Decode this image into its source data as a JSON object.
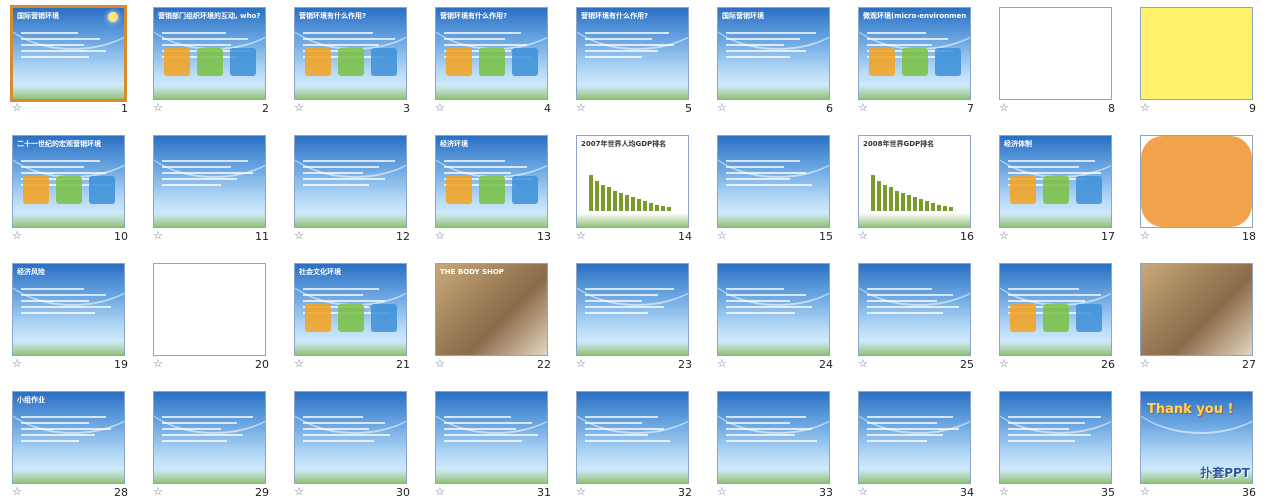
{
  "slides": [
    {
      "n": "1",
      "t": "国际营销环境",
      "v": "sel"
    },
    {
      "n": "2",
      "t": "营销部门组织环境的互动, who?",
      "v": "diag"
    },
    {
      "n": "3",
      "t": "营销环境有什么作用?",
      "v": "diag"
    },
    {
      "n": "4",
      "t": "营销环境有什么作用?",
      "v": "diag"
    },
    {
      "n": "5",
      "t": "营销环境有什么作用?",
      "v": "text"
    },
    {
      "n": "6",
      "t": "国际营销环境",
      "v": "text"
    },
    {
      "n": "7",
      "t": "微观环境(micro-environment)",
      "v": "diag"
    },
    {
      "n": "8",
      "t": "",
      "v": "white"
    },
    {
      "n": "9",
      "t": "",
      "v": "yellow"
    },
    {
      "n": "10",
      "t": "二十一世纪的宏观营销环境",
      "v": "diag"
    },
    {
      "n": "11",
      "t": "",
      "v": "text"
    },
    {
      "n": "12",
      "t": "",
      "v": "text"
    },
    {
      "n": "13",
      "t": "经济环境",
      "v": "diag"
    },
    {
      "n": "14",
      "t": "2007年世界人均GDP排名",
      "v": "chart"
    },
    {
      "n": "15",
      "t": "",
      "v": "text"
    },
    {
      "n": "16",
      "t": "2008年世界GDP排名",
      "v": "chart"
    },
    {
      "n": "17",
      "t": "经济体制",
      "v": "diag"
    },
    {
      "n": "18",
      "t": "",
      "v": "cloud"
    },
    {
      "n": "19",
      "t": "经济风险",
      "v": "text"
    },
    {
      "n": "20",
      "t": "",
      "v": "white"
    },
    {
      "n": "21",
      "t": "社会文化环境",
      "v": "diag"
    },
    {
      "n": "22",
      "t": "THE BODY SHOP",
      "v": "photo"
    },
    {
      "n": "23",
      "t": "",
      "v": "text"
    },
    {
      "n": "24",
      "t": "",
      "v": "text"
    },
    {
      "n": "25",
      "t": "",
      "v": "text"
    },
    {
      "n": "26",
      "t": "",
      "v": "diag"
    },
    {
      "n": "27",
      "t": "",
      "v": "photo"
    },
    {
      "n": "28",
      "t": "小组作业",
      "v": "text"
    },
    {
      "n": "29",
      "t": "",
      "v": "text"
    },
    {
      "n": "30",
      "t": "",
      "v": "text"
    },
    {
      "n": "31",
      "t": "",
      "v": "text"
    },
    {
      "n": "32",
      "t": "",
      "v": "text"
    },
    {
      "n": "33",
      "t": "",
      "v": "text"
    },
    {
      "n": "34",
      "t": "",
      "v": "text"
    },
    {
      "n": "35",
      "t": "",
      "v": "text"
    },
    {
      "n": "36",
      "t": "Thank you !",
      "v": "thanks"
    }
  ],
  "watermark": "扑套PPT",
  "star_glyph": "☆",
  "colors": {
    "selected_border": "#d98a2c",
    "slide_sky": "#6aa6e2",
    "chart_bar": "#7a9a2a"
  }
}
